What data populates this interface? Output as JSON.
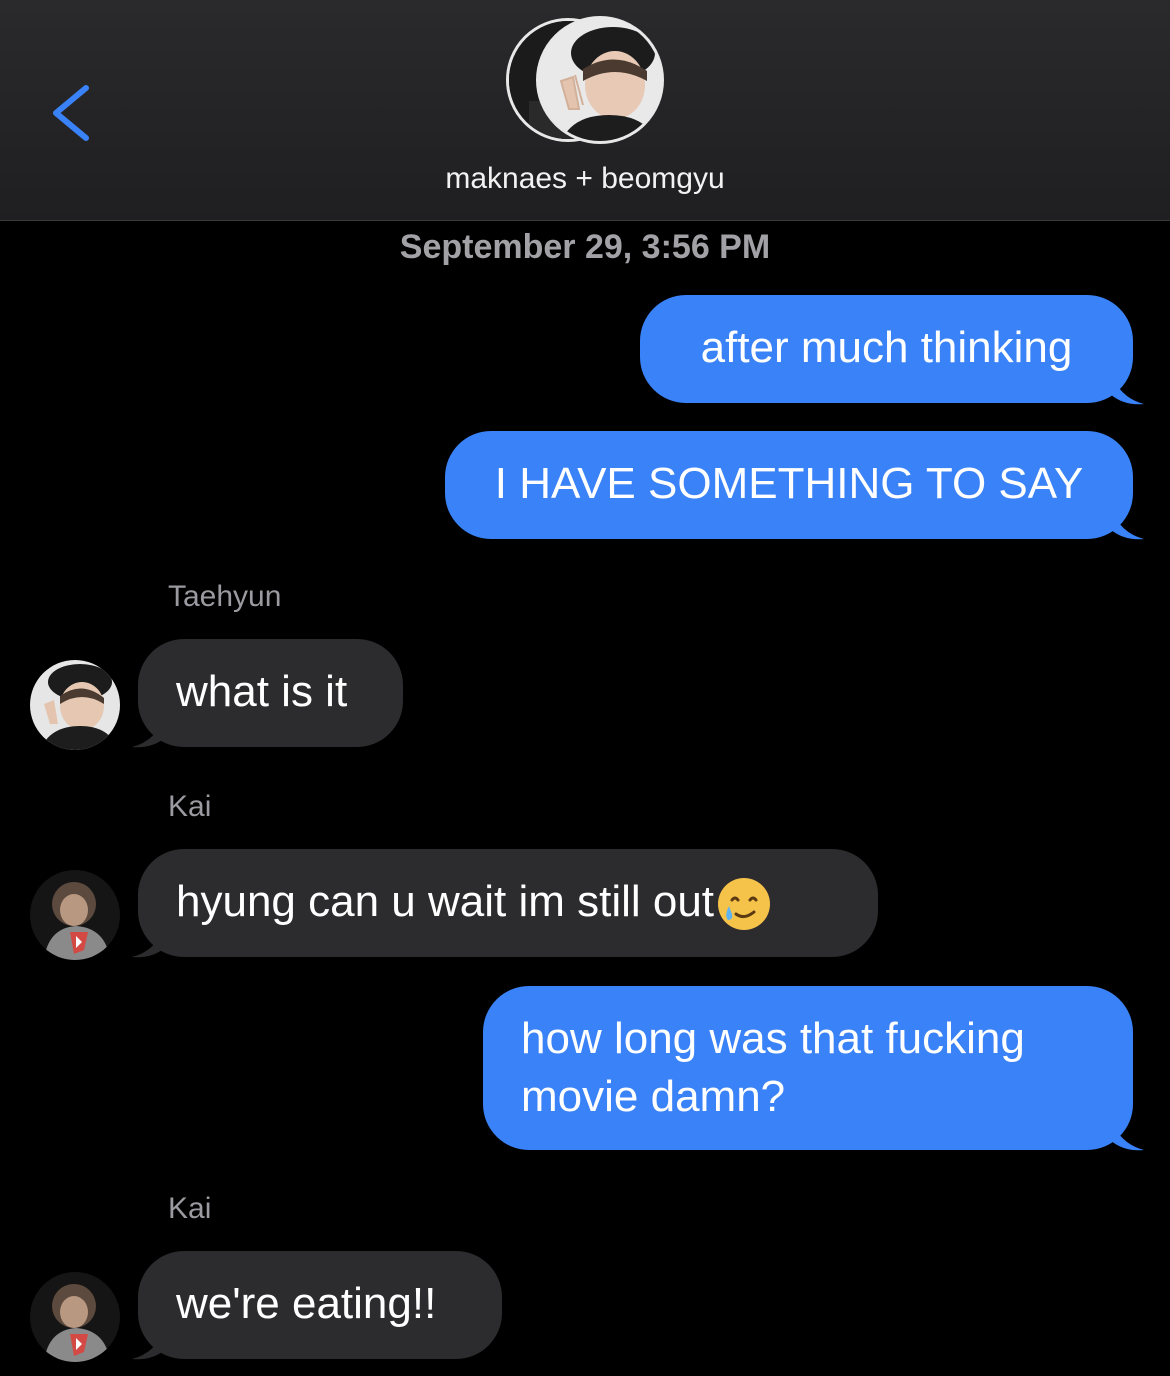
{
  "header": {
    "back_icon": "chevron-left-icon",
    "group_name": "maknaes + beomgyu",
    "accent_color": "#3a82f7"
  },
  "timestamp": "September 29, 3:56 PM",
  "messages": [
    {
      "direction": "sent",
      "text": "after much thinking"
    },
    {
      "direction": "sent",
      "text": "I HAVE SOMETHING TO SAY"
    },
    {
      "direction": "received",
      "sender": "Taehyun",
      "text": "what is it"
    },
    {
      "direction": "received",
      "sender": "Kai",
      "text": "hyung can u wait im still out",
      "emoji": "smiling-face-with-tear-icon"
    },
    {
      "direction": "sent",
      "text_line1": "how long was that fucking",
      "text_line2": "movie damn?"
    },
    {
      "direction": "received",
      "sender": "Kai",
      "text": "we're eating!!"
    }
  ],
  "colors": {
    "sent_bubble": "#3a82f7",
    "received_bubble": "#2c2c2e",
    "background": "#000000"
  }
}
